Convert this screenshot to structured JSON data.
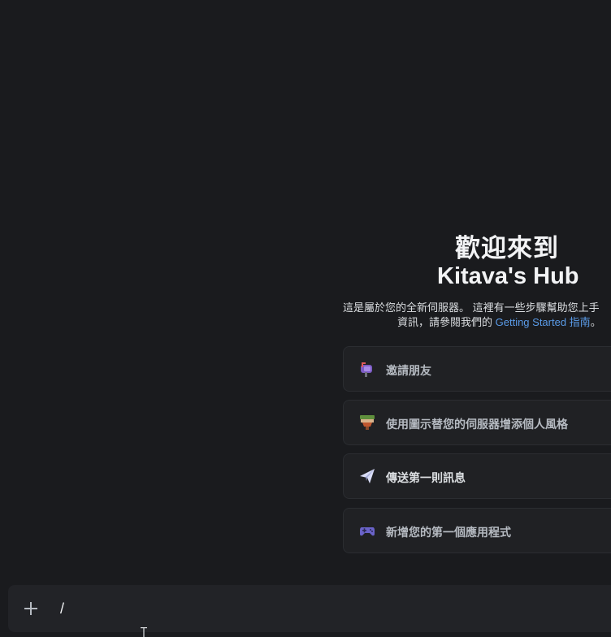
{
  "welcome": {
    "title_line1": "歡迎來到",
    "title_line2": "Kitava's Hub",
    "desc_part1": "這是屬於您的全新伺服器。 這裡有一些步驟幫助您上手",
    "desc_part2": "資訊，請參閱我們的 ",
    "desc_link": "Getting Started 指南",
    "desc_part3": "。"
  },
  "actions": [
    {
      "label": "邀請朋友",
      "icon": "mailbox-icon"
    },
    {
      "label": "使用圖示替您的伺服器增添個人風格",
      "icon": "paint-brush-icon"
    },
    {
      "label": "傳送第一則訊息",
      "icon": "paper-plane-icon"
    },
    {
      "label": "新增您的第一個應用程式",
      "icon": "gamepad-icon"
    }
  ],
  "composer": {
    "value": "/",
    "plus_icon": "plus-icon"
  },
  "colors": {
    "background": "#1a1b1e",
    "card": "#202124",
    "link": "#5a9be8",
    "text": "#dbdee1"
  }
}
